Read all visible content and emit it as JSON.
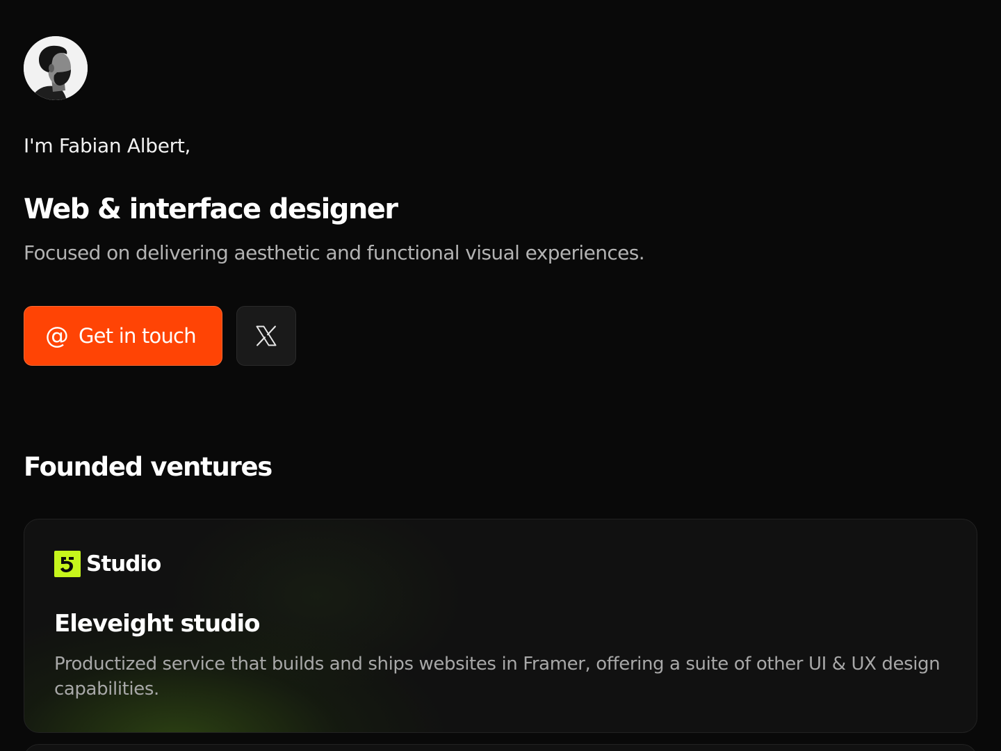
{
  "profile": {
    "avatar_icon": "avatar-portrait",
    "intro": "I'm Fabian Albert,",
    "role": "Web & interface designer",
    "tagline": "Focused on delivering aesthetic and functional visual experiences."
  },
  "actions": {
    "contact_icon": "at-sign-icon",
    "contact_glyph": "@",
    "contact_label": "Get in touch",
    "social_icon": "x-logo-icon"
  },
  "ventures": {
    "section_title": "Founded ventures",
    "items": [
      {
        "brand_icon": "eleveight-logo",
        "brand_name": "Studio",
        "title": "Eleveight studio",
        "description": "Productized service that builds and ships websites in Framer, offering a suite of other UI & UX design capabilities."
      }
    ]
  },
  "colors": {
    "background": "#090909",
    "accent": "#ff4405",
    "brand_lime": "#c6f51c"
  }
}
